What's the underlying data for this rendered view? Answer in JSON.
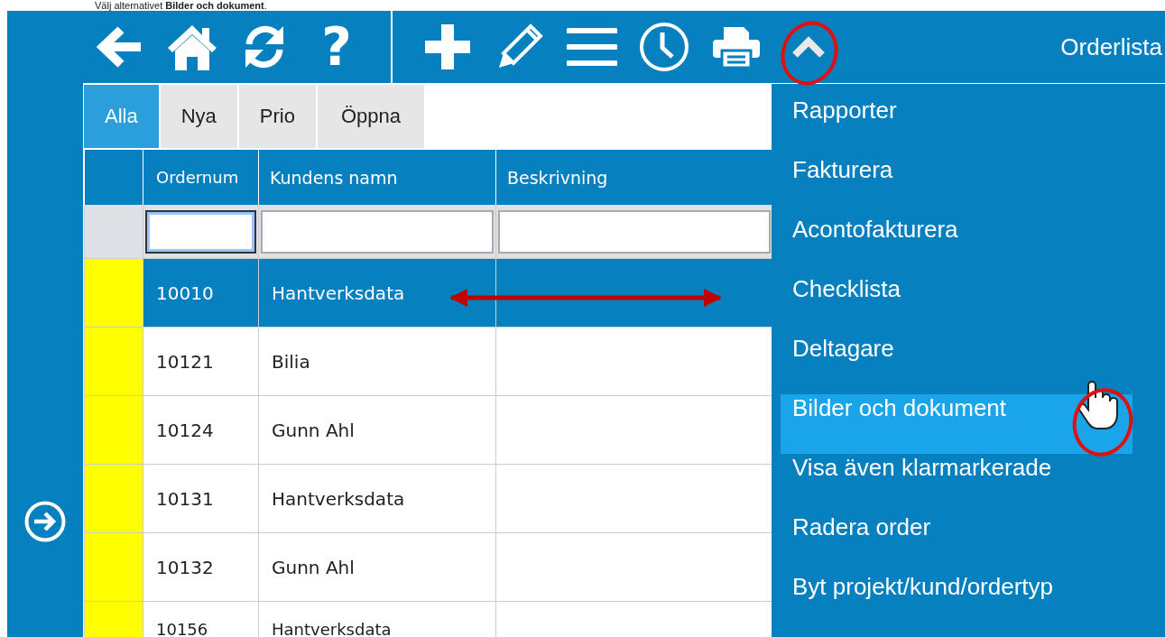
{
  "instruction": "Välj alternativet **Bilder och dokument**.",
  "toolbar": {
    "help_glyph": "?",
    "title": "Orderlista"
  },
  "tabs": [
    {
      "label": "Alla",
      "selected": true
    },
    {
      "label": "Nya",
      "selected": false
    },
    {
      "label": "Prio",
      "selected": false
    },
    {
      "label": "Öppna",
      "selected": false
    }
  ],
  "table": {
    "columns": [
      "Ordernum",
      "Kundens namn",
      "Beskrivning"
    ],
    "filters": [
      {
        "focused": true
      },
      {
        "focused": false
      },
      {
        "focused": false
      }
    ],
    "rows": [
      {
        "order_number": "10010",
        "customer": "Hantverksdata",
        "selected": true
      },
      {
        "order_number": "10121",
        "customer": "Bilia",
        "selected": false
      },
      {
        "order_number": "10124",
        "customer": "Gunn Ahl",
        "selected": false
      },
      {
        "order_number": "10131",
        "customer": "Hantverksdata",
        "selected": false
      },
      {
        "order_number": "10132",
        "customer": "Gunn Ahl",
        "selected": false
      },
      {
        "order_number": "10156",
        "customer": "Hantverksdata",
        "selected": false
      }
    ]
  },
  "menu": {
    "items": [
      {
        "label": "Rapporter",
        "selected": false
      },
      {
        "label": "Fakturera",
        "selected": false
      },
      {
        "label": "Acontofakturera",
        "selected": false
      },
      {
        "label": "Checklista",
        "selected": false
      },
      {
        "label": "Deltagare",
        "selected": false
      },
      {
        "label": "Bilder och dokument",
        "selected": true
      },
      {
        "label": "Visa även klarmarkerade",
        "selected": false
      },
      {
        "label": "Radera order",
        "selected": false
      },
      {
        "label": "Byt projekt/kund/ordertyp",
        "selected": false
      }
    ]
  }
}
